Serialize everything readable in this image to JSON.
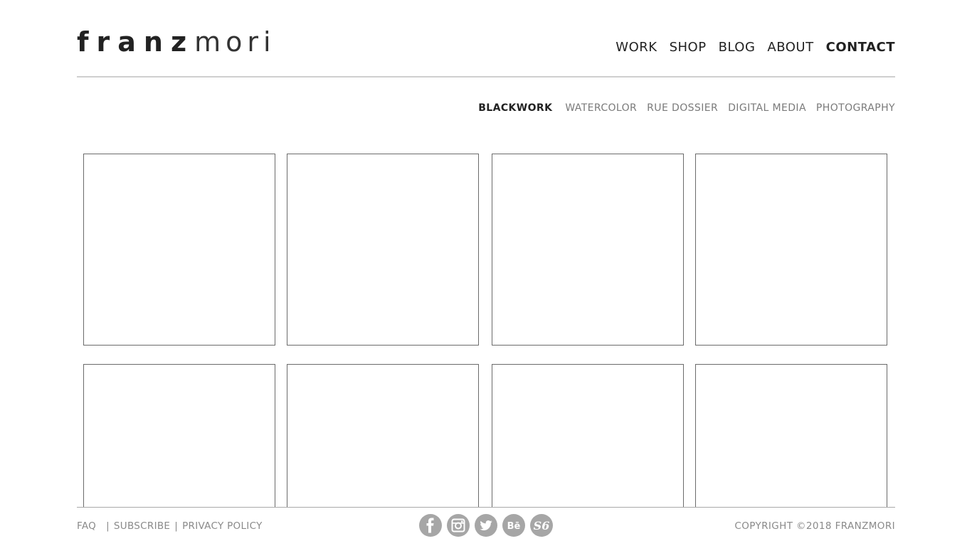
{
  "brand": {
    "logo_bold": "franz",
    "logo_light": "mori"
  },
  "main_nav": {
    "items": [
      {
        "label": "WORK"
      },
      {
        "label": "SHOP"
      },
      {
        "label": "BLOG"
      },
      {
        "label": "ABOUT"
      },
      {
        "label": "CONTACT",
        "active": true
      }
    ]
  },
  "sub_nav": {
    "items": [
      {
        "label": "BLACKWORK",
        "active": true
      },
      {
        "label": "WATERCOLOR"
      },
      {
        "label": "RUE DOSSIER"
      },
      {
        "label": "DIGITAL MEDIA"
      },
      {
        "label": "PHOTOGRAPHY"
      }
    ]
  },
  "gallery": {
    "tile_count": 8
  },
  "footer": {
    "links": [
      {
        "label": "FAQ"
      },
      {
        "label": "SUBSCRIBE"
      },
      {
        "label": "PRIVACY POLICY"
      }
    ],
    "separator": "|",
    "social_icons": [
      "facebook-icon",
      "instagram-icon",
      "twitter-icon",
      "behance-icon",
      "society6-icon"
    ],
    "copyright": "COPYRIGHT ©2018 FRANZMORI"
  },
  "colors": {
    "text_dark": "#222222",
    "text_muted": "#8a8a8a",
    "tile_border": "#6b6b6b",
    "rule": "#cfcfcf",
    "social_bg": "#a6a6a6"
  }
}
